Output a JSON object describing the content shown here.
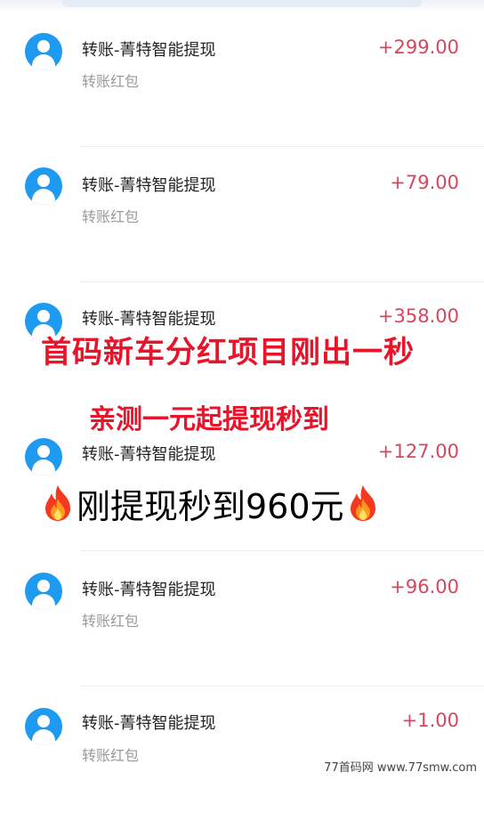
{
  "transactions": [
    {
      "title": "转账-菁特智能提现",
      "subtitle": "转账红包",
      "amount": "+299.00"
    },
    {
      "title": "转账-菁特智能提现",
      "subtitle": "转账红包",
      "amount": "+79.00"
    },
    {
      "title": "转账-菁特智能提现",
      "subtitle": "",
      "amount": "+358.00"
    },
    {
      "title": "转账-菁特智能提现",
      "subtitle": "",
      "amount": "+127.00"
    },
    {
      "title": "转账-菁特智能提现",
      "subtitle": "转账红包",
      "amount": "+96.00"
    },
    {
      "title": "转账-菁特智能提现",
      "subtitle": "转账红包",
      "amount": "+1.00"
    }
  ],
  "overlay": {
    "line1": "首码新车分红项目刚出一秒",
    "line2": "亲测一元起提现秒到",
    "line3": "刚提现秒到960元",
    "fire_icon": "fire-emoji"
  },
  "watermark": "77首码网 www.77smw.com",
  "colors": {
    "amount": "#d9455d",
    "avatar": "#1e9bf0",
    "promo_red": "#e8142a"
  }
}
